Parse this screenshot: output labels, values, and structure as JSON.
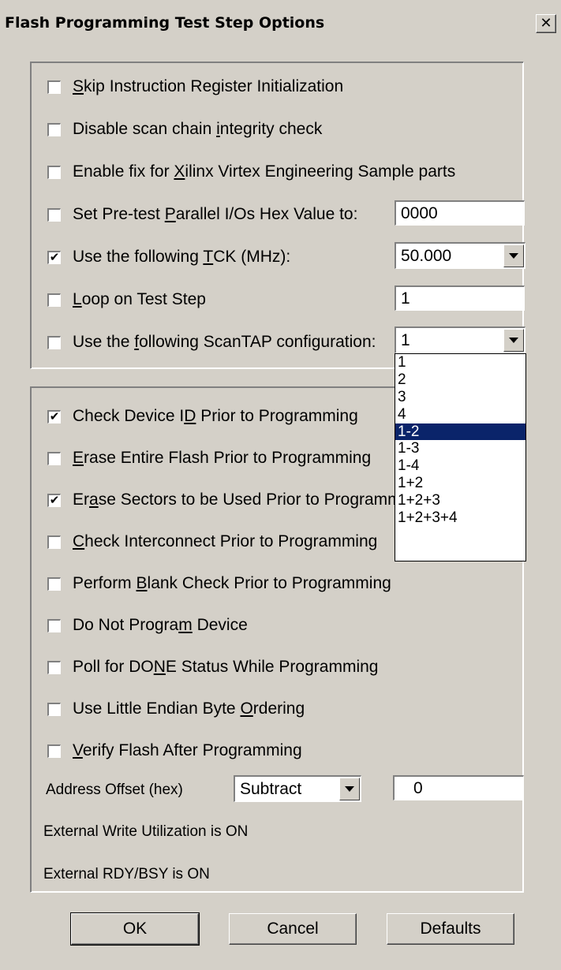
{
  "window": {
    "title": "Flash Programming Test Step Options",
    "close_glyph": "✕"
  },
  "group1": {
    "skip_ir": {
      "pre": "",
      "key": "S",
      "post": "kip Instruction Register Initialization",
      "checked": false
    },
    "disable_scan": {
      "pre": "Disable scan chain ",
      "key": "i",
      "post": "ntegrity check",
      "checked": false
    },
    "xilinx_fix": {
      "pre": "Enable fix for ",
      "key": "X",
      "post": "ilinx Virtex Engineering Sample parts",
      "checked": false
    },
    "pretest_io": {
      "pre": "Set Pre-test ",
      "key": "P",
      "post": "arallel I/Os Hex Value to:",
      "checked": false,
      "value": "0000"
    },
    "tck": {
      "pre": "Use the following ",
      "key": "T",
      "post": "CK (MHz):",
      "checked": true,
      "value": "50.000"
    },
    "loop": {
      "pre": "",
      "key": "L",
      "post": "oop on Test Step",
      "checked": false,
      "value": "1"
    },
    "scantap": {
      "pre": "Use the ",
      "key": "f",
      "post": "ollowing ScanTAP configuration:",
      "checked": false,
      "value": "1"
    }
  },
  "scantap_options": [
    "1",
    "2",
    "3",
    "4",
    "1-2",
    "1-3",
    "1-4",
    "1+2",
    "1+2+3",
    "1+2+3+4"
  ],
  "scantap_highlighted": "1-2",
  "group2": {
    "check_id": {
      "pre": "Check Device I",
      "key": "D",
      "post": " Prior to Programming",
      "checked": true
    },
    "erase_entire": {
      "pre": "",
      "key": "E",
      "post": "rase Entire Flash Prior to Programming",
      "checked": false
    },
    "erase_sectors": {
      "pre": "Er",
      "key": "a",
      "post": "se Sectors to be Used Prior to Programm",
      "checked": true
    },
    "check_interconnect": {
      "pre": "",
      "key": "C",
      "post": "heck Interconnect Prior to Programming",
      "checked": false
    },
    "blank_check": {
      "pre": "Perform ",
      "key": "B",
      "post": "lank Check Prior to Programming",
      "checked": false
    },
    "no_program": {
      "pre": "Do Not Progra",
      "key": "m",
      "post": " Device",
      "checked": false
    },
    "poll_done": {
      "pre": "Poll for DO",
      "key": "N",
      "post": "E Status While Programming",
      "checked": false
    },
    "little_endian": {
      "pre": "Use Little Endian Byte ",
      "key": "O",
      "post": "rdering",
      "checked": false
    },
    "verify": {
      "pre": "",
      "key": "V",
      "post": "erify Flash After Programming",
      "checked": false
    },
    "address_offset_label": "Address Offset (hex)",
    "address_offset_mode": "Subtract",
    "address_offset_value": "0",
    "ext_write": "External Write Utilization is ON",
    "ext_rdy": "External RDY/BSY is ON"
  },
  "buttons": {
    "ok": "OK",
    "cancel": "Cancel",
    "defaults": "Defaults"
  },
  "check_glyph": "✔"
}
